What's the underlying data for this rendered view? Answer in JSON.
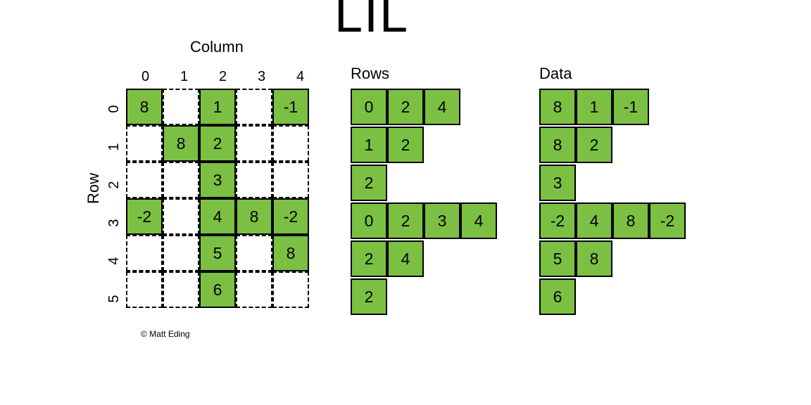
{
  "title": "LIL",
  "labels": {
    "column": "Column",
    "row": "Row",
    "rows": "Rows",
    "data": "Data"
  },
  "copyright": "© Matt Eding",
  "chart_data": {
    "type": "table",
    "description": "LIL (List of Lists) sparse matrix format diagram",
    "matrix": {
      "rows": 6,
      "cols": 5,
      "col_headers": [
        "0",
        "1",
        "2",
        "3",
        "4"
      ],
      "row_headers": [
        "0",
        "1",
        "2",
        "3",
        "4",
        "5"
      ],
      "cells": [
        [
          {
            "v": "8",
            "f": true
          },
          {
            "v": "",
            "f": false
          },
          {
            "v": "1",
            "f": true
          },
          {
            "v": "",
            "f": false
          },
          {
            "v": "-1",
            "f": true
          }
        ],
        [
          {
            "v": "",
            "f": false
          },
          {
            "v": "8",
            "f": true
          },
          {
            "v": "2",
            "f": true
          },
          {
            "v": "",
            "f": false
          },
          {
            "v": "",
            "f": false
          }
        ],
        [
          {
            "v": "",
            "f": false
          },
          {
            "v": "",
            "f": false
          },
          {
            "v": "3",
            "f": true
          },
          {
            "v": "",
            "f": false
          },
          {
            "v": "",
            "f": false
          }
        ],
        [
          {
            "v": "-2",
            "f": true
          },
          {
            "v": "",
            "f": false
          },
          {
            "v": "4",
            "f": true
          },
          {
            "v": "8",
            "f": true
          },
          {
            "v": "-2",
            "f": true
          }
        ],
        [
          {
            "v": "",
            "f": false
          },
          {
            "v": "",
            "f": false
          },
          {
            "v": "5",
            "f": true
          },
          {
            "v": "",
            "f": false
          },
          {
            "v": "8",
            "f": true
          }
        ],
        [
          {
            "v": "",
            "f": false
          },
          {
            "v": "",
            "f": false
          },
          {
            "v": "6",
            "f": true
          },
          {
            "v": "",
            "f": false
          },
          {
            "v": "",
            "f": false
          }
        ]
      ]
    },
    "rows_list": [
      [
        "0",
        "2",
        "4"
      ],
      [
        "1",
        "2"
      ],
      [
        "2"
      ],
      [
        "0",
        "2",
        "3",
        "4"
      ],
      [
        "2",
        "4"
      ],
      [
        "2"
      ]
    ],
    "data_list": [
      [
        "8",
        "1",
        "-1"
      ],
      [
        "8",
        "2"
      ],
      [
        "3"
      ],
      [
        "-2",
        "4",
        "8",
        "-2"
      ],
      [
        "5",
        "8"
      ],
      [
        "6"
      ]
    ]
  }
}
